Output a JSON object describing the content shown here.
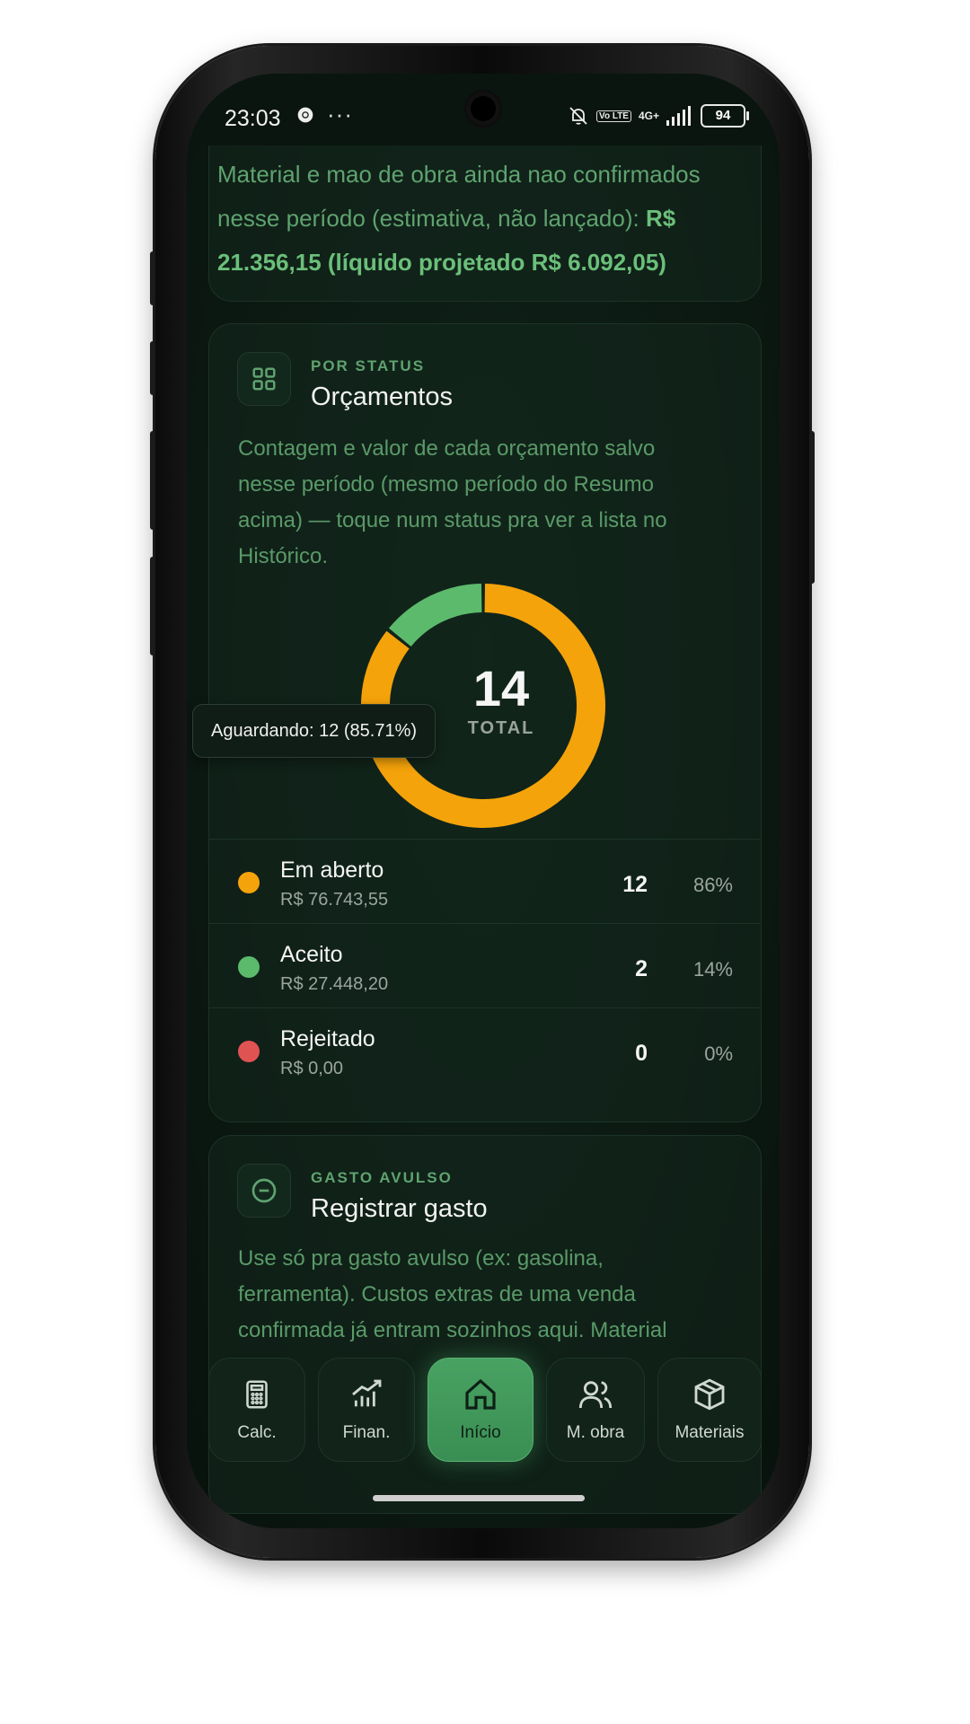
{
  "status_bar": {
    "time": "23:03",
    "dots": "···",
    "volte": "Vo LTE",
    "network": "4G+",
    "battery": "94"
  },
  "summary_note": {
    "text": "Material e mao de obra ainda nao confirmados nesse período (estimativa, não lançado): ",
    "bold": "R$ 21.356,15 (líquido projetado R$ 6.092,05)"
  },
  "status_card": {
    "eyebrow": "POR STATUS",
    "title": "Orçamentos",
    "description": "Contagem e valor de cada orçamento salvo nesse período (mesmo período do Resumo acima) — toque num status pra ver a lista no Histórico.",
    "icon": "grid-icon",
    "total_value": "14",
    "total_label": "TOTAL",
    "tooltip": "Aguardando: 12 (85.71%)"
  },
  "chart_data": {
    "type": "pie",
    "variant": "donut",
    "categories": [
      "Em aberto",
      "Aceito",
      "Rejeitado"
    ],
    "values": [
      12,
      2,
      0
    ],
    "colors": [
      "#f5a30a",
      "#5cba6c",
      "#e05353"
    ]
  },
  "status_rows": [
    {
      "name": "Em aberto",
      "value": "R$ 76.743,55",
      "count": "12",
      "pct": "86%",
      "color": "#f5a30a"
    },
    {
      "name": "Aceito",
      "value": "R$ 27.448,20",
      "count": "2",
      "pct": "14%",
      "color": "#5cba6c"
    },
    {
      "name": "Rejeitado",
      "value": "R$ 0,00",
      "count": "0",
      "pct": "0%",
      "color": "#e05353"
    }
  ],
  "expense_card": {
    "eyebrow": "GASTO AVULSO",
    "title": "Registrar gasto",
    "icon": "minus-circle-icon",
    "description": "Use só pra gasto avulso (ex: gasolina, ferramenta). Custos extras de uma venda confirmada já entram sozinhos aqui. Material"
  },
  "bottom_nav": [
    {
      "label": "Calc.",
      "icon": "calculator-icon"
    },
    {
      "label": "Finan.",
      "icon": "chart-icon"
    },
    {
      "label": "Início",
      "icon": "home-icon",
      "active": true
    },
    {
      "label": "M. obra",
      "icon": "users-icon"
    },
    {
      "label": "Materiais",
      "icon": "box-icon"
    }
  ]
}
